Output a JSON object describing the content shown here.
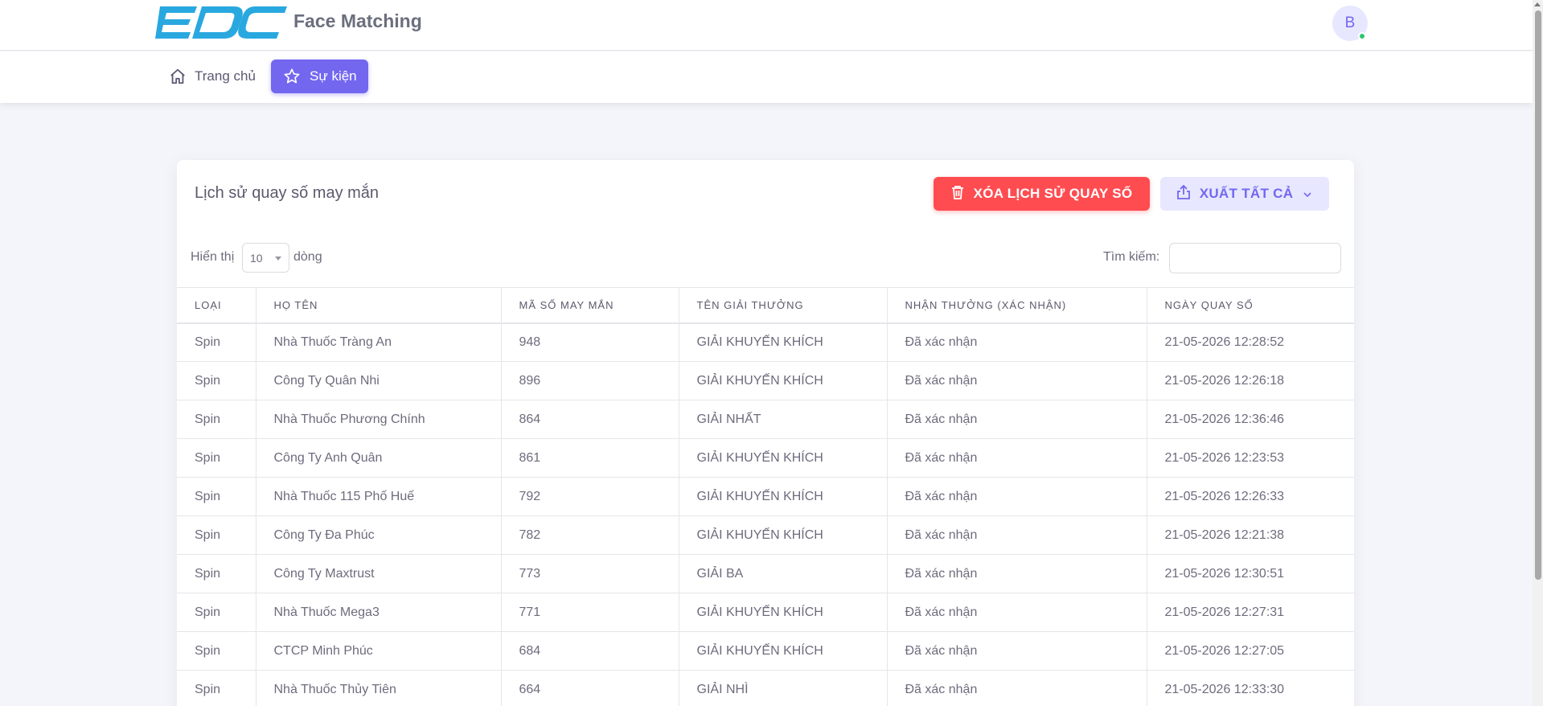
{
  "header": {
    "logo_text": "EDC",
    "app_title": "Face Matching",
    "avatar_initial": "B"
  },
  "nav": {
    "home_label": "Trang chủ",
    "event_label": "Sự kiện"
  },
  "card": {
    "title": "Lịch sử quay số may mắn",
    "delete_button": "XÓA LỊCH SỬ QUAY SỐ",
    "export_button": "XUẤT TẤT CẢ",
    "show_label": "Hiển thị",
    "page_size": "10",
    "rows_label": "dòng",
    "search_label": "Tìm kiếm:",
    "search_value": ""
  },
  "table": {
    "columns": [
      "LOẠI",
      "HỌ TÊN",
      "MÃ SỐ MAY MẮN",
      "TÊN GIẢI THƯỞNG",
      "NHẬN THƯỞNG (XÁC NHẬN)",
      "NGÀY QUAY SỐ"
    ],
    "rows": [
      [
        "Spin",
        "Nhà Thuốc Tràng An",
        "948",
        "GIẢI KHUYẾN KHÍCH",
        "Đã xác nhận",
        "21-05-2026 12:28:52"
      ],
      [
        "Spin",
        "Công Ty Quân Nhi",
        "896",
        "GIẢI KHUYẾN KHÍCH",
        "Đã xác nhận",
        "21-05-2026 12:26:18"
      ],
      [
        "Spin",
        "Nhà Thuốc Phương Chính",
        "864",
        "GIẢI NHẤT",
        "Đã xác nhận",
        "21-05-2026 12:36:46"
      ],
      [
        "Spin",
        "Công Ty Anh Quân",
        "861",
        "GIẢI KHUYẾN KHÍCH",
        "Đã xác nhận",
        "21-05-2026 12:23:53"
      ],
      [
        "Spin",
        "Nhà Thuốc 115 Phố Huế",
        "792",
        "GIẢI KHUYẾN KHÍCH",
        "Đã xác nhận",
        "21-05-2026 12:26:33"
      ],
      [
        "Spin",
        "Công Ty Đa Phúc",
        "782",
        "GIẢI KHUYẾN KHÍCH",
        "Đã xác nhận",
        "21-05-2026 12:21:38"
      ],
      [
        "Spin",
        "Công Ty Maxtrust",
        "773",
        "GIẢI BA",
        "Đã xác nhận",
        "21-05-2026 12:30:51"
      ],
      [
        "Spin",
        "Nhà Thuốc Mega3",
        "771",
        "GIẢI KHUYẾN KHÍCH",
        "Đã xác nhận",
        "21-05-2026 12:27:31"
      ],
      [
        "Spin",
        "CTCP Minh Phúc",
        "684",
        "GIẢI KHUYẾN KHÍCH",
        "Đã xác nhận",
        "21-05-2026 12:27:05"
      ],
      [
        "Spin",
        "Nhà Thuốc Thủy Tiên",
        "664",
        "GIẢI NHÌ",
        "Đã xác nhận",
        "21-05-2026 12:33:30"
      ]
    ]
  },
  "colors": {
    "brand_blue": "#29a8e0",
    "primary": "#7367f0",
    "danger": "#ff4c51",
    "online": "#28c76f"
  }
}
